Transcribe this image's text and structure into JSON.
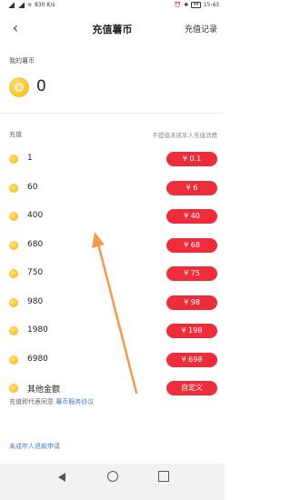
{
  "statusbar": {
    "left_text": "830 K/s",
    "time": "15:43",
    "battery": "44"
  },
  "header": {
    "back_glyph": "‹",
    "title": "充值薯币",
    "records_label": "充值记录"
  },
  "wallet": {
    "label": "我的薯币",
    "balance": "0"
  },
  "recharge": {
    "label": "充值",
    "notice": "不提倡未成年人充值消费",
    "options": [
      {
        "amount": "1",
        "price": "¥ 0.1"
      },
      {
        "amount": "60",
        "price": "¥ 6"
      },
      {
        "amount": "400",
        "price": "¥ 40"
      },
      {
        "amount": "680",
        "price": "¥ 68"
      },
      {
        "amount": "750",
        "price": "¥ 75"
      },
      {
        "amount": "980",
        "price": "¥ 98"
      },
      {
        "amount": "1980",
        "price": "¥ 198"
      },
      {
        "amount": "6980",
        "price": "¥ 698"
      },
      {
        "amount": "其他金额",
        "price": "自定义"
      }
    ]
  },
  "footer": {
    "agreement_prefix": "充值即代表同意",
    "agreement_link": "薯币服务协议",
    "refund_link": "未成年人退款申请"
  },
  "colors": {
    "price_button": "#ee2d3a",
    "coin": "#f5b100",
    "link": "#4a7dbf",
    "annotation_arrow": "#f39a4a"
  }
}
